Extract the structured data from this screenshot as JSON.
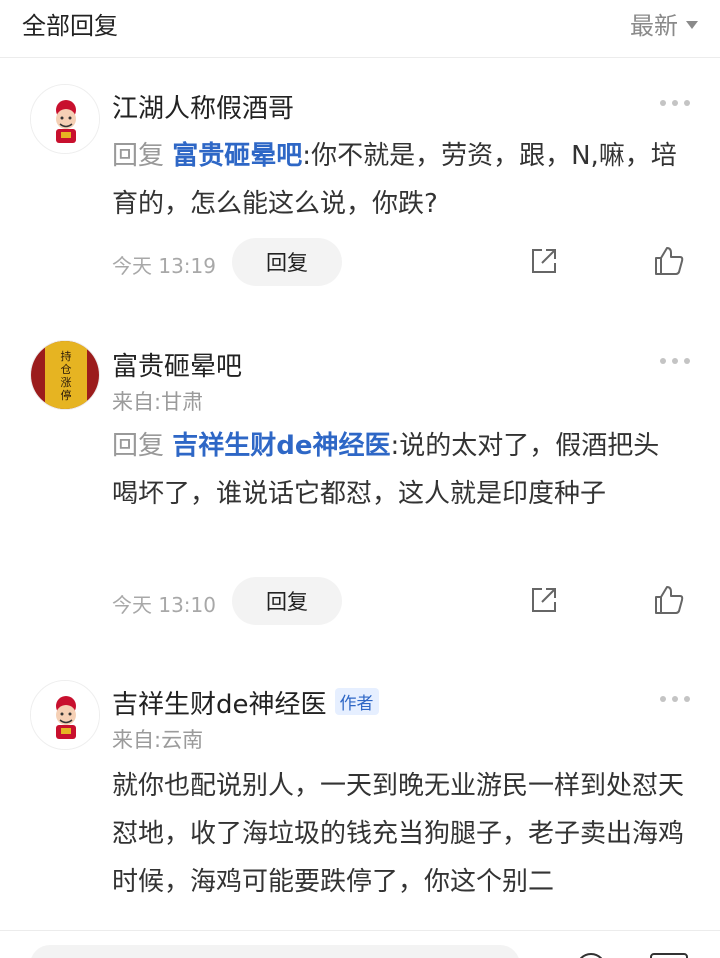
{
  "header": {
    "title": "全部回复",
    "sort_label": "最新"
  },
  "comments": [
    {
      "name": "江湖人称假酒哥",
      "reply_prefix": "回复",
      "mention": "富贵砸晕吧",
      "colon": ":",
      "text": "你不就是，劳资，跟，N,嘛，培育的，怎么能这么说，你跌?",
      "time": "今天 13:19",
      "reply_label": "回复"
    },
    {
      "name": "富贵砸晕吧",
      "location": "来自:甘肃",
      "reply_prefix": "回复",
      "mention": "吉祥生财de神经医",
      "colon": ":",
      "text": "说的太对了，假酒把头喝坏了，谁说话它都怼，这人就是印度种子",
      "time": "今天 13:10",
      "reply_label": "回复",
      "avatar_text": "持仓涨停"
    },
    {
      "name": "吉祥生财de神经医",
      "author_tag": "作者",
      "location": "来自:云南",
      "text": "就你也配说别人，一天到晚无业游民一样到处怼天怼地，收了海垃圾的钱充当狗腿子，老子卖出海鸡时候，海鸡可能要跌停了，你这个别二"
    }
  ],
  "colors": {
    "mention": "#2e67c6",
    "meta": "#a8a8a8",
    "avatar_red": "#9b1c1c",
    "avatar_gold": "#e6b422"
  }
}
